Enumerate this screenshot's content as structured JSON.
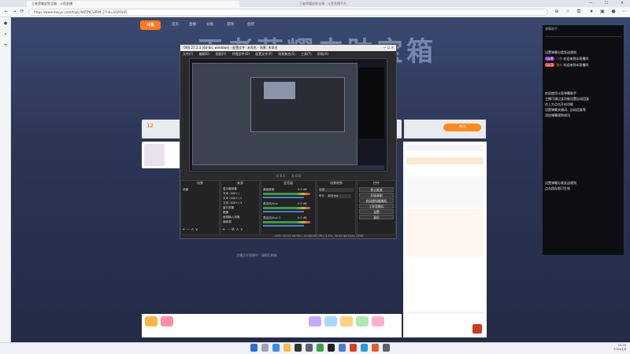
{
  "browser": {
    "tab_title": "王者荣耀皮肤宝箱 - 斗鱼直播",
    "window_title": "王者荣耀皮肤宝箱 - 斗鱼直播平台",
    "url": "https://www.douyu.com/topic/WZRYCSPRM_2?rid=1026545",
    "min": "—",
    "max": "☐",
    "close": "✕"
  },
  "site": {
    "logo": "斗鱼",
    "nav": [
      "首页",
      "直播",
      "分类",
      "游戏",
      "鱼吧"
    ],
    "banner": "王者荣耀皮肤宝箱",
    "room_number": "12",
    "follow_label": "关注",
    "bottom_text": "主播正在直播中 · 请稍后刷新"
  },
  "obs": {
    "title": "OBS 27.2.3 (64-bit, windows) - 配置文件: 未命名 - 场景: 未命名",
    "menu": [
      "文件(F)",
      "编辑(E)",
      "视图(V)",
      "停靠部件(D)",
      "配置文件(P)",
      "场景集合(S)",
      "工具(T)",
      "帮助(H)"
    ],
    "stats": [
      "⓪ 0.1",
      "⓪ 0.0"
    ],
    "docks": [
      "场景",
      "来源",
      "混音器",
      "场景转换",
      "控件"
    ],
    "scenes": [
      "场景"
    ],
    "sources": [
      "显示器采集",
      "文本 (GDI+)",
      "文本 (GDI+) 2",
      "文本 (GDI+) 3",
      "窗口采集",
      "图像",
      "音频输入采集",
      "媒体源"
    ],
    "mixer": [
      {
        "name": "桌面音频",
        "db": "0.0 dB"
      },
      {
        "name": "麦克风/Aux",
        "db": "0.0 dB"
      },
      {
        "name": "麦克风/Aux 2",
        "db": "0.0 dB"
      }
    ],
    "transition": {
      "type": "淡出",
      "duration_label": "时长",
      "duration": "300 ms"
    },
    "controls": [
      "停止推流",
      "开始录制",
      "启动虚拟摄像机",
      "工作室模式",
      "设置",
      "退出"
    ],
    "status": "LIVE: 00:12:34   REC: 00:00:00   CPU: 3.4%, 30.00 fps   kb/s: 2500"
  },
  "chat_overlay": {
    "header": "弹幕助手",
    "lines": [
      {
        "text": "设置弹幕分类发送规则"
      },
      {
        "badge": "Lv.8",
        "user": "小鱼",
        "text": "欢迎来到本直播间"
      },
      {
        "badge": "Lv.3",
        "user": "观众",
        "text": "欢迎来到本直播间"
      },
      {
        "text": "欢迎使用斗鱼弹幕助手"
      },
      {
        "text": "主播可通过该功能设置自动回复"
      },
      {
        "text": "在上方点击开启功能"
      },
      {
        "text": "设置弹幕关键词、自动回复等"
      },
      {
        "text": "添加弹幕规则成功"
      },
      {
        "text": "设置弹幕分类发送规则"
      },
      {
        "text": "点击保存即可生效"
      }
    ]
  },
  "clock": {
    "time": "15:34",
    "date": "2022/4/8"
  },
  "colors": {
    "accent": "#ff7a1a",
    "obs_bg": "#2b2b2e",
    "page_bg": "#2c3556"
  }
}
